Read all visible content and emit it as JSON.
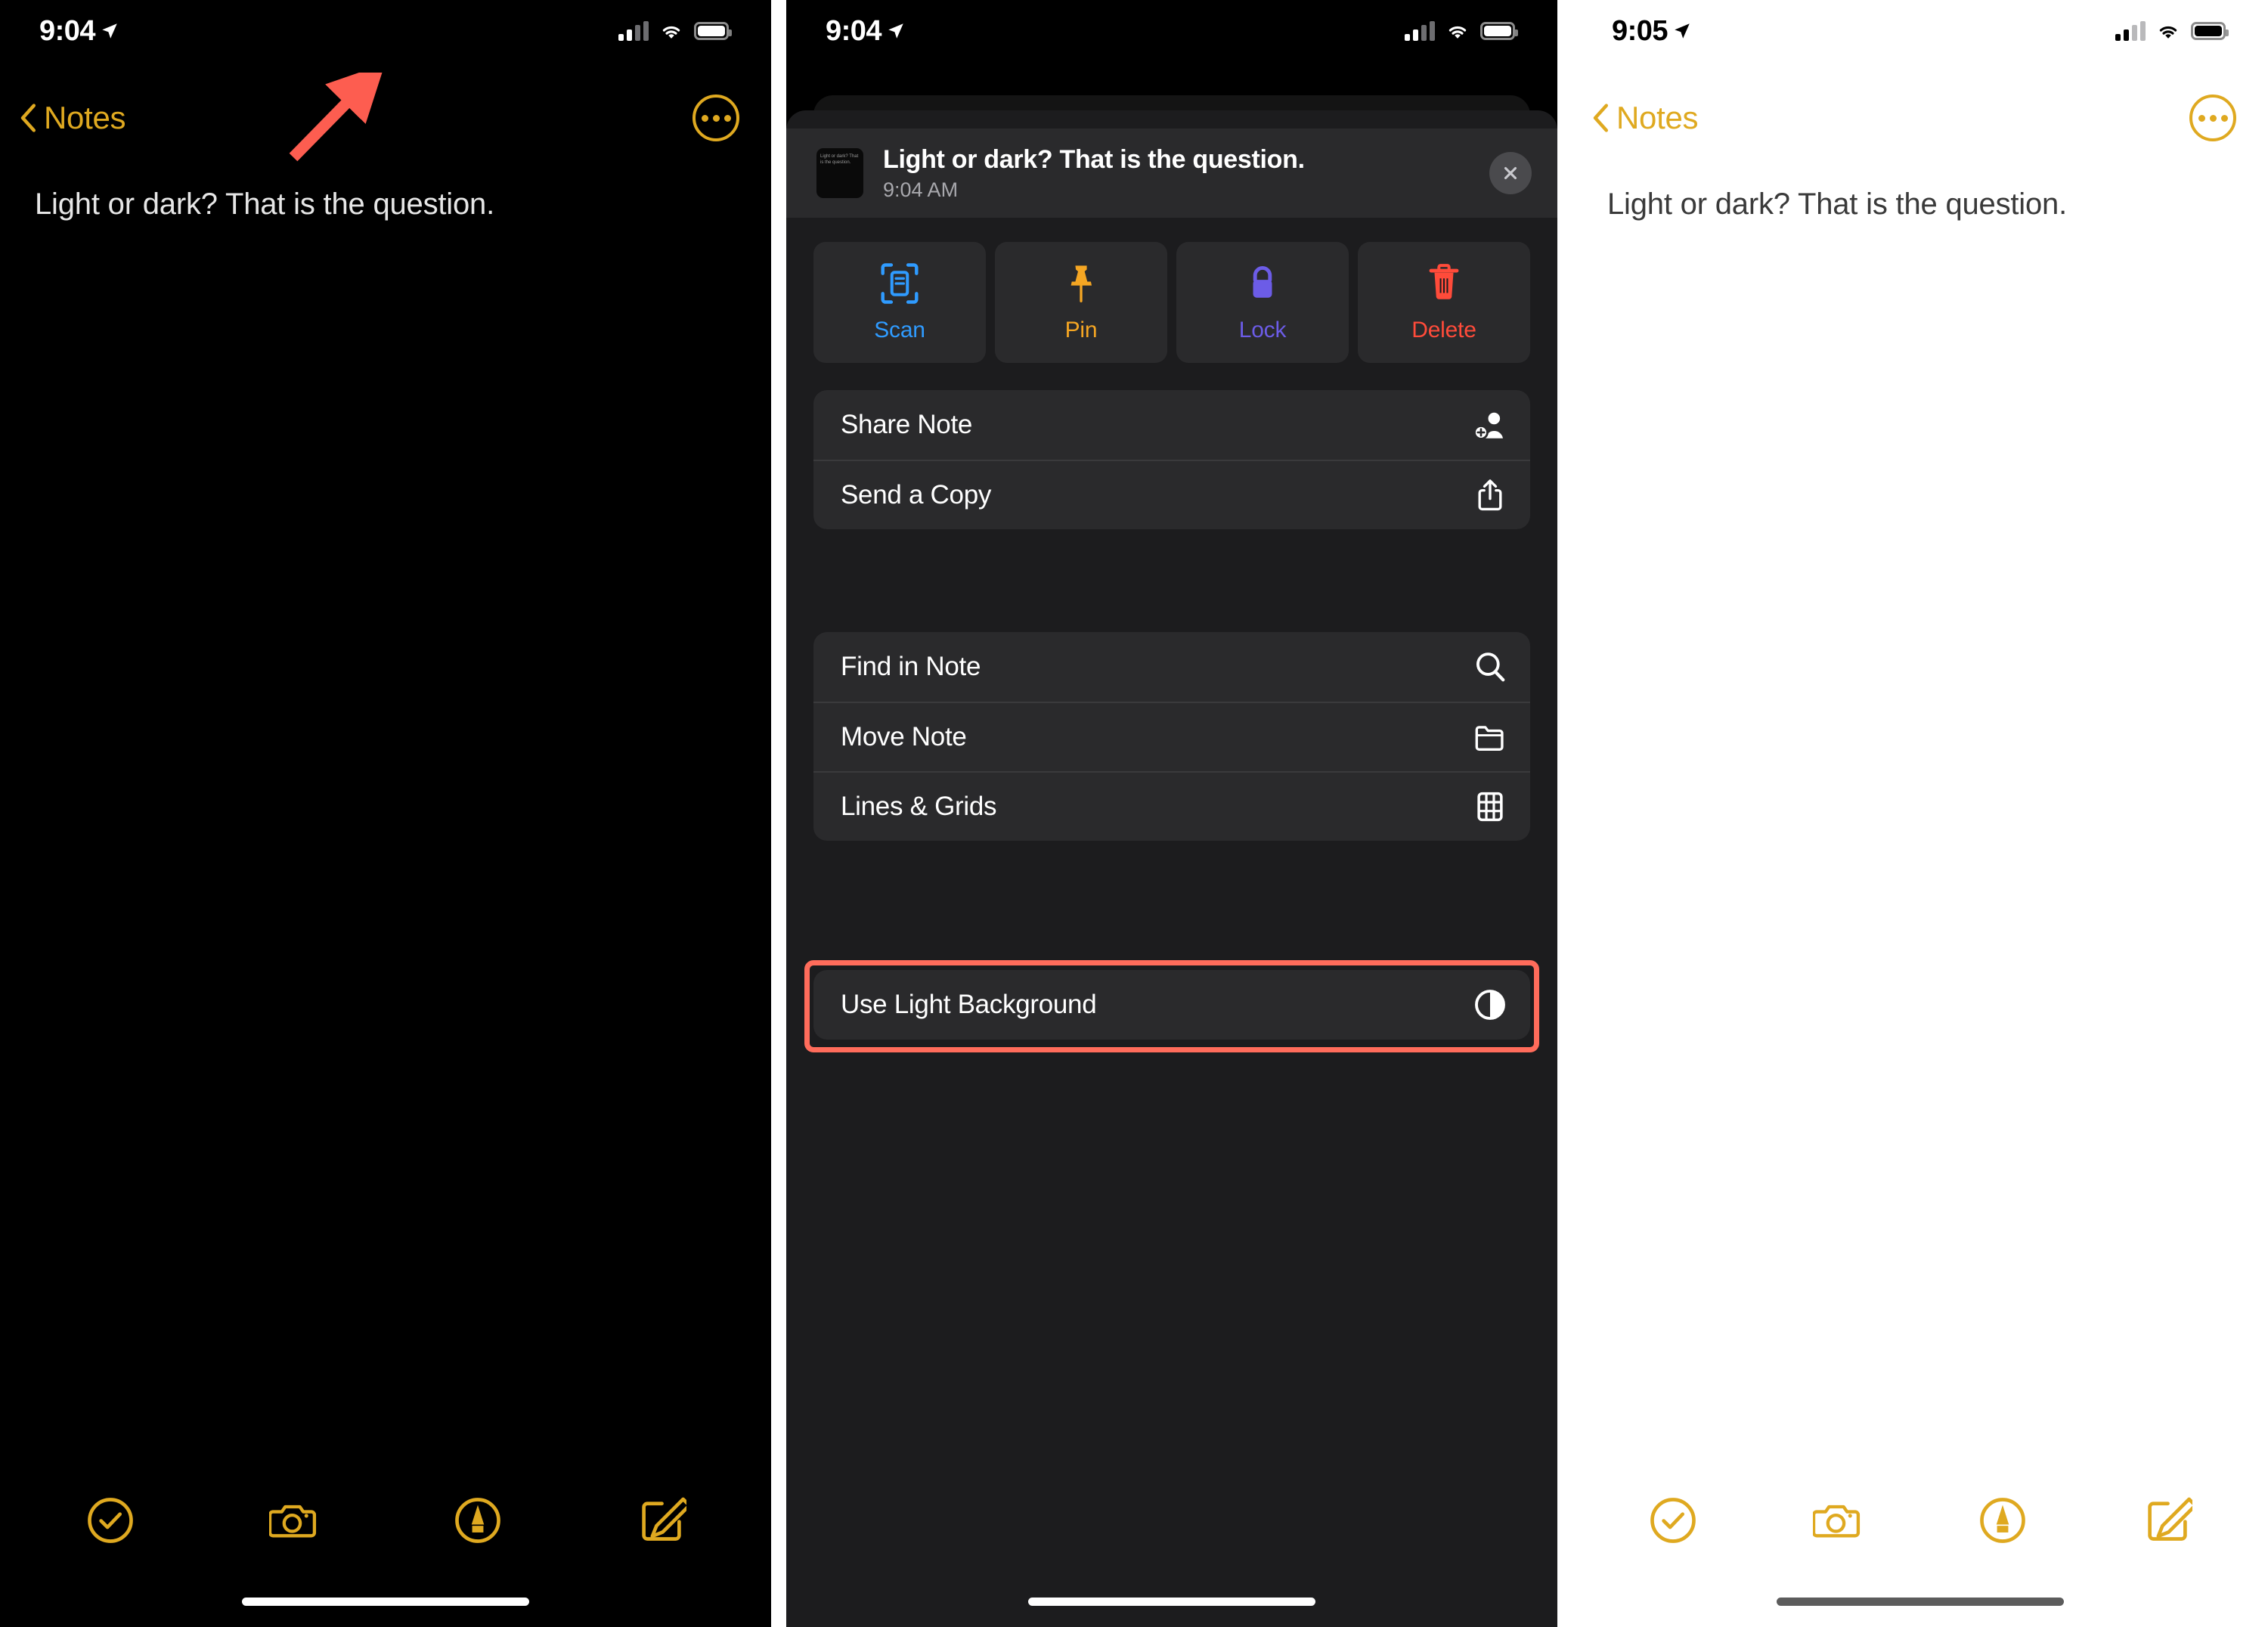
{
  "panels": [
    {
      "id": "dark-note",
      "theme": "dark",
      "status": {
        "time": "9:04",
        "location_icon": "location-arrow-icon",
        "wifi_icon": "wifi-icon",
        "battery_icon": "battery-icon",
        "signal_icon": "cellular-signal-icon"
      },
      "nav": {
        "back_label": "Notes",
        "back_icon": "chevron-left-icon",
        "more_icon": "more-ellipsis-icon"
      },
      "note": {
        "body": "Light or dark? That is the question."
      },
      "toolbar": [
        {
          "name": "checklist-button",
          "icon": "checkmark-circle-icon"
        },
        {
          "name": "camera-button",
          "icon": "camera-icon"
        },
        {
          "name": "markup-button",
          "icon": "markup-pen-circle-icon"
        },
        {
          "name": "compose-button",
          "icon": "compose-pencil-icon"
        }
      ],
      "annotation": {
        "type": "arrow",
        "color": "#fd5d50",
        "points_to": "more-ellipsis-icon"
      }
    },
    {
      "id": "share-sheet",
      "theme": "dark",
      "status": {
        "time": "9:04"
      },
      "note_header": {
        "title": "Light or dark? That is the question.",
        "time": "9:04 AM",
        "thumbnail_text": "Light or dark? That is the question.",
        "close_icon": "close-x-icon"
      },
      "quick_actions": [
        {
          "label": "Scan",
          "icon": "scan-document-icon",
          "color": "#2f9bff"
        },
        {
          "label": "Pin",
          "icon": "pin-icon",
          "color": "#f5a623"
        },
        {
          "label": "Lock",
          "icon": "lock-icon",
          "color": "#6c5ce7"
        },
        {
          "label": "Delete",
          "icon": "trash-icon",
          "color": "#ff4b3a"
        }
      ],
      "menu_groups": [
        {
          "items": [
            {
              "label": "Share Note",
              "icon": "person-add-icon"
            },
            {
              "label": "Send a Copy",
              "icon": "share-upload-icon"
            }
          ]
        },
        {
          "items": [
            {
              "label": "Find in Note",
              "icon": "magnifier-icon"
            },
            {
              "label": "Move Note",
              "icon": "folder-icon"
            },
            {
              "label": "Lines & Grids",
              "icon": "grid-icon"
            }
          ]
        },
        {
          "items": [
            {
              "label": "Use Light Background",
              "icon": "contrast-half-circle-icon",
              "highlighted": true
            }
          ]
        }
      ],
      "highlight_color": "#ff6c5b"
    },
    {
      "id": "light-note",
      "theme": "light",
      "status": {
        "time": "9:05"
      },
      "nav": {
        "back_label": "Notes",
        "back_icon": "chevron-left-icon",
        "more_icon": "more-ellipsis-icon"
      },
      "note": {
        "body": "Light or dark? That is the question."
      },
      "toolbar": [
        {
          "name": "checklist-button",
          "icon": "checkmark-circle-icon"
        },
        {
          "name": "camera-button",
          "icon": "camera-icon"
        },
        {
          "name": "markup-button",
          "icon": "markup-pen-circle-icon"
        },
        {
          "name": "compose-button",
          "icon": "compose-pencil-icon"
        }
      ]
    }
  ],
  "colors": {
    "accent_yellow": "#dfa920",
    "highlight_red": "#ff6c5b",
    "arrow_red": "#fd5d50"
  }
}
